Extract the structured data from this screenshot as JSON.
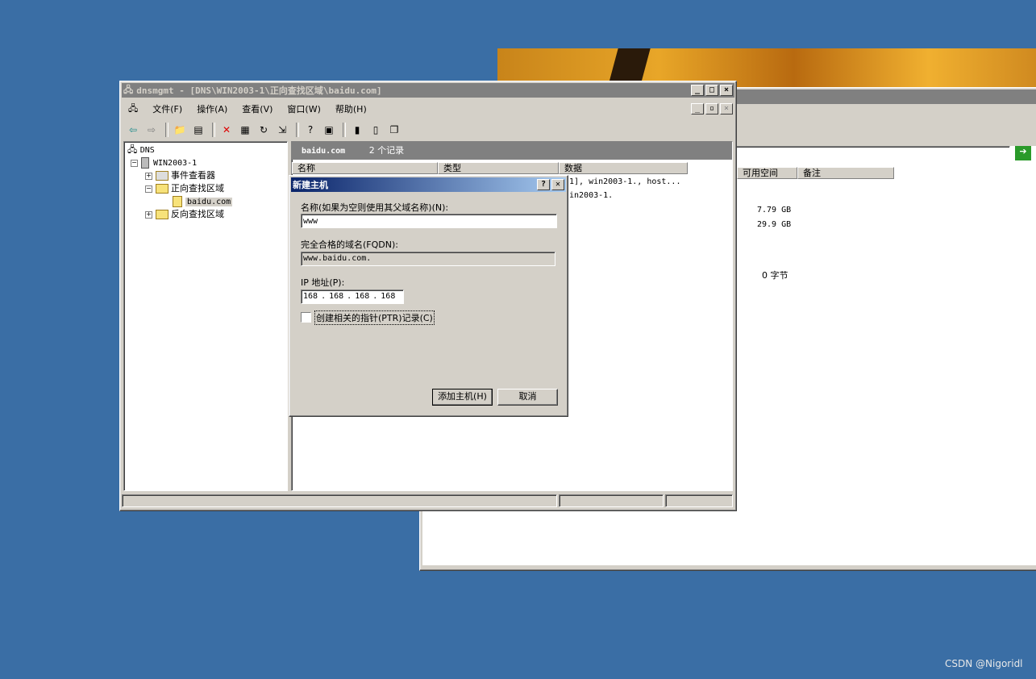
{
  "background_window": {
    "col_free_space": "可用空间",
    "col_notes": "备注",
    "values": [
      "7.79 GB",
      "29.9 GB",
      "0 字节"
    ]
  },
  "main_window": {
    "title": "dnsmgmt - [DNS\\WIN2003-1\\正向查找区域\\baidu.com]",
    "menu": [
      "文件(F)",
      "操作(A)",
      "查看(V)",
      "窗口(W)",
      "帮助(H)"
    ],
    "tree": {
      "root": "DNS",
      "server": "WIN2003-1",
      "event_viewer": "事件查看器",
      "forward_zones": "正向查找区域",
      "zone": "baidu.com",
      "reverse_zones": "反向查找区域"
    },
    "pane_header": {
      "zone": "baidu.com",
      "count": "2 个记录"
    },
    "columns": [
      "名称",
      "类型",
      "数据"
    ],
    "rows_partial": [
      "1], win2003-1., host...",
      "in2003-1."
    ]
  },
  "dialog": {
    "title": "新建主机",
    "name_label": "名称(如果为空则使用其父域名称)(N):",
    "name_value": "www",
    "fqdn_label": "完全合格的域名(FQDN):",
    "fqdn_value": "www.baidu.com.",
    "ip_label": "IP 地址(P):",
    "ip_octets": [
      "168",
      "168",
      "168",
      "168"
    ],
    "ptr_label": "创建相关的指针(PTR)记录(C)",
    "add_button": "添加主机(H)",
    "cancel_button": "取消",
    "help_glyph": "?",
    "close_glyph": "✕"
  },
  "watermark": "CSDN @Nigoridl"
}
